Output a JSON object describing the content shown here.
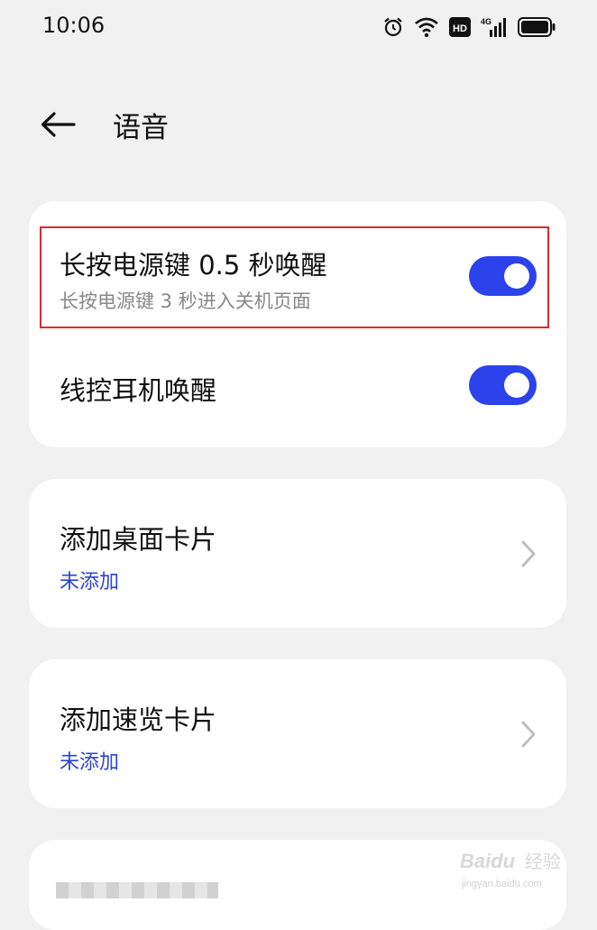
{
  "status_bar": {
    "time": "10:06",
    "icons": [
      "alarm-icon",
      "wifi-icon",
      "hd-icon",
      "cellular-4g-icon",
      "battery-icon"
    ],
    "hd_label": "HD",
    "network_label": "4G"
  },
  "header": {
    "back_icon": "back-arrow-icon",
    "title": "语音"
  },
  "voice_card": {
    "power_key_wake": {
      "title": "长按电源键 0.5 秒唤醒",
      "subtitle": "长按电源键 3 秒进入关机页面",
      "enabled": true
    },
    "headset_wake": {
      "title": "线控耳机唤醒",
      "enabled": true
    }
  },
  "desktop_card": {
    "title": "添加桌面卡片",
    "status": "未添加"
  },
  "quick_view_card": {
    "title": "添加速览卡片",
    "status": "未添加"
  },
  "watermark": {
    "brand": "Baidu",
    "sub": "经验",
    "url": "jingyan.baidu.com"
  },
  "colors": {
    "background": "#f1f1f1",
    "card": "#ffffff",
    "toggle_on": "#2c42ea",
    "link_blue": "#2d45d9",
    "highlight_red": "#e0292e"
  }
}
